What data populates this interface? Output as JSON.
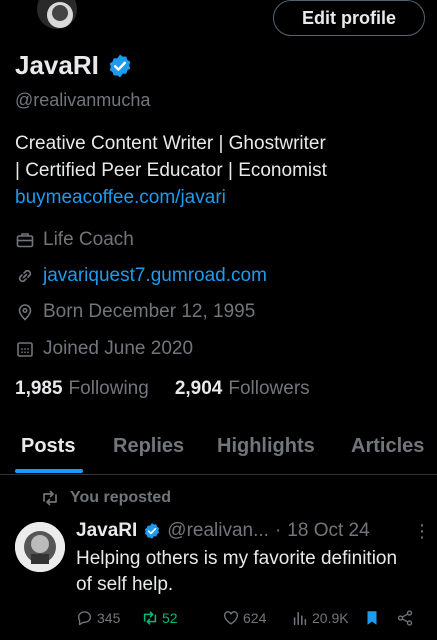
{
  "header": {
    "edit_profile_label": "Edit profile"
  },
  "profile": {
    "display_name": "JavaRI",
    "handle": "@realivanmucha",
    "bio_line1": "Creative Content Writer | Ghostwriter",
    "bio_line2": "| Certified Peer Educator | Economist",
    "bio_link": "buymeacoffee.com/javari",
    "profession": "Life Coach",
    "website": "javariquest7.gumroad.com",
    "born": "Born December 12, 1995",
    "joined": "Joined June 2020",
    "following_count": "1,985",
    "following_label": "Following",
    "followers_count": "2,904",
    "followers_label": "Followers"
  },
  "tabs": [
    {
      "label": "Posts",
      "active": true
    },
    {
      "label": "Replies",
      "active": false
    },
    {
      "label": "Highlights",
      "active": false
    },
    {
      "label": "Articles",
      "active": false
    }
  ],
  "feed": {
    "repost_label": "You reposted",
    "tweet": {
      "author": "JavaRI",
      "handle": "@realivan...",
      "separator": "·",
      "date": "18 Oct 24",
      "text": "Helping others is my favorite definition of self help.",
      "replies": "345",
      "reposts": "52",
      "likes": "624",
      "views": "20.9K"
    }
  },
  "colors": {
    "accent": "#1d9bf0",
    "repost_green": "#00ba7c",
    "muted": "#71767b",
    "text": "#e7e9ea",
    "background": "#000000"
  },
  "icons": [
    "verified-badge-icon",
    "briefcase-icon",
    "link-icon",
    "location-pin-icon",
    "calendar-icon",
    "repost-icon",
    "reply-icon",
    "like-icon",
    "views-icon",
    "bookmark-icon",
    "share-icon",
    "more-icon"
  ]
}
